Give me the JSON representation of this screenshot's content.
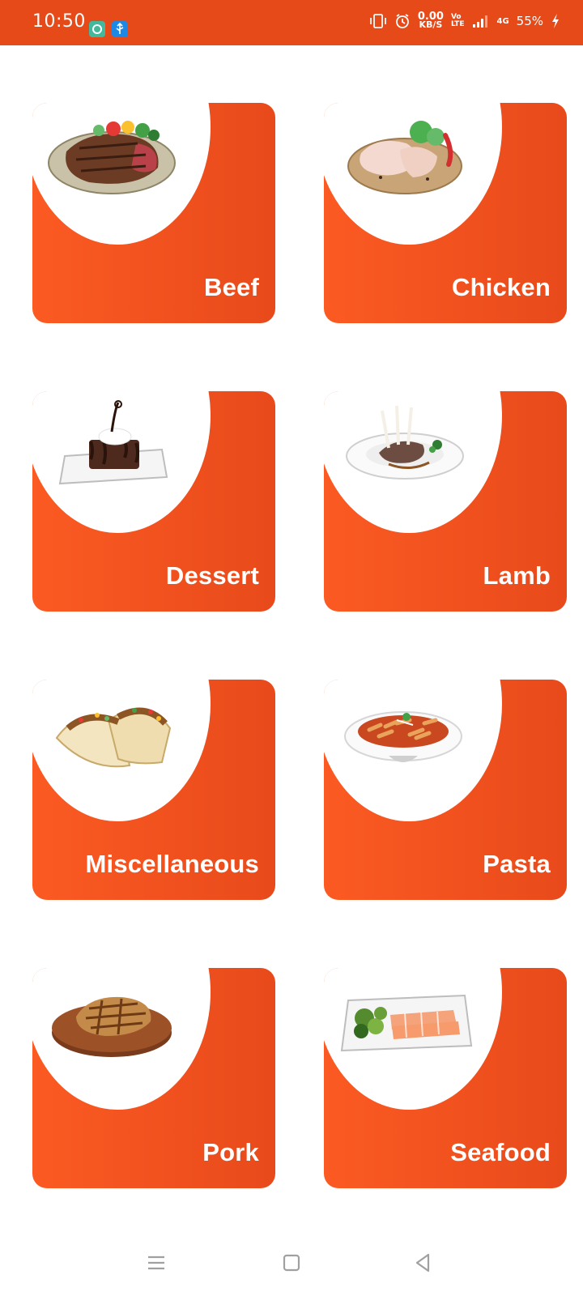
{
  "status_bar": {
    "time": "10:50",
    "net_speed_value": "0.00",
    "net_speed_unit": "KB/S",
    "volte_top": "Vo",
    "volte_bottom": "LTE",
    "network_type": "4G",
    "battery": "55%",
    "icons": [
      "chat-app-icon",
      "usb-icon",
      "vibrate-icon",
      "alarm-icon",
      "signal-icon",
      "charging-icon"
    ]
  },
  "colors": {
    "accent": "#e64a19",
    "card_gradient_start": "#fb5a22",
    "card_gradient_end": "#e84a1b"
  },
  "categories": [
    {
      "label": "Beef",
      "image": "beef-steak"
    },
    {
      "label": "Chicken",
      "image": "raw-chicken"
    },
    {
      "label": "Dessert",
      "image": "chocolate-cake"
    },
    {
      "label": "Lamb",
      "image": "lamb-chops"
    },
    {
      "label": "Miscellaneous",
      "image": "tacos"
    },
    {
      "label": "Pasta",
      "image": "penne-pasta"
    },
    {
      "label": "Pork",
      "image": "pork-chop"
    },
    {
      "label": "Seafood",
      "image": "salmon-plate"
    }
  ],
  "nav_bar": {
    "buttons": [
      "recents-button",
      "home-button",
      "back-button"
    ]
  }
}
